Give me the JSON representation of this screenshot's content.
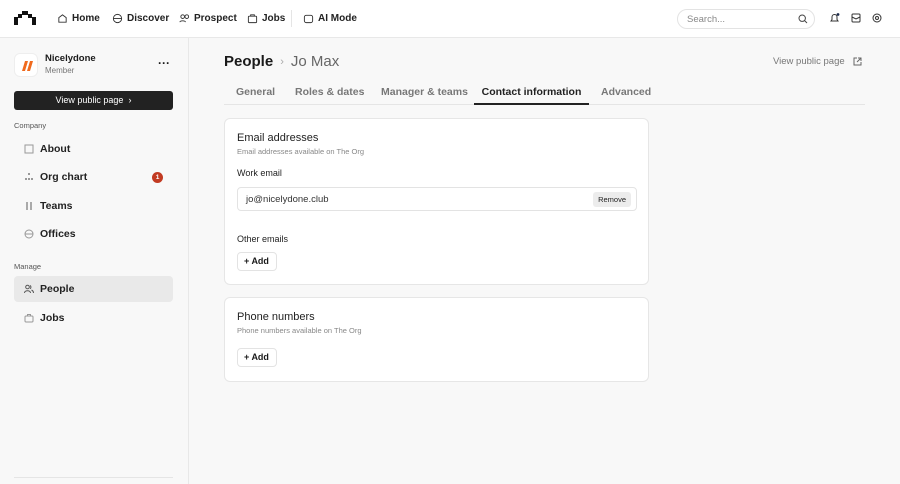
{
  "topnav": {
    "items": [
      {
        "label": "Home",
        "icon": "home-icon"
      },
      {
        "label": "Discover",
        "icon": "globe-icon"
      },
      {
        "label": "Prospect",
        "icon": "users-icon"
      },
      {
        "label": "Jobs",
        "icon": "briefcase-icon"
      },
      {
        "label": "AI Mode",
        "icon": "ai-icon"
      }
    ],
    "search_placeholder": "Search..."
  },
  "sidebar": {
    "org_name": "Nicelydone",
    "org_role": "Member",
    "view_public_page": "View public page",
    "sections": [
      {
        "title": "Company"
      },
      {
        "title": "Manage"
      }
    ],
    "items": [
      {
        "label": "About"
      },
      {
        "label": "Org chart",
        "badge": "1"
      },
      {
        "label": "Teams"
      },
      {
        "label": "Offices"
      },
      {
        "label": "People",
        "active": true
      },
      {
        "label": "Jobs"
      }
    ]
  },
  "header": {
    "crumb_root": "People",
    "crumb_current": "Jo Max",
    "view_public_page": "View public page"
  },
  "tabs": [
    {
      "label": "General"
    },
    {
      "label": "Roles & dates"
    },
    {
      "label": "Manager & teams"
    },
    {
      "label": "Contact information",
      "active": true
    },
    {
      "label": "Advanced"
    }
  ],
  "email_card": {
    "title": "Email addresses",
    "subtitle": "Email addresses available on The Org",
    "work_label": "Work email",
    "work_value": "jo@nicelydone.club",
    "remove": "Remove",
    "other_label": "Other emails",
    "add": "Add"
  },
  "phone_card": {
    "title": "Phone numbers",
    "subtitle": "Phone numbers available on The Org",
    "add": "Add"
  },
  "colors": {
    "accent": "#222222",
    "badge": "#c23b22",
    "logo_orange": "#f06a1d"
  }
}
